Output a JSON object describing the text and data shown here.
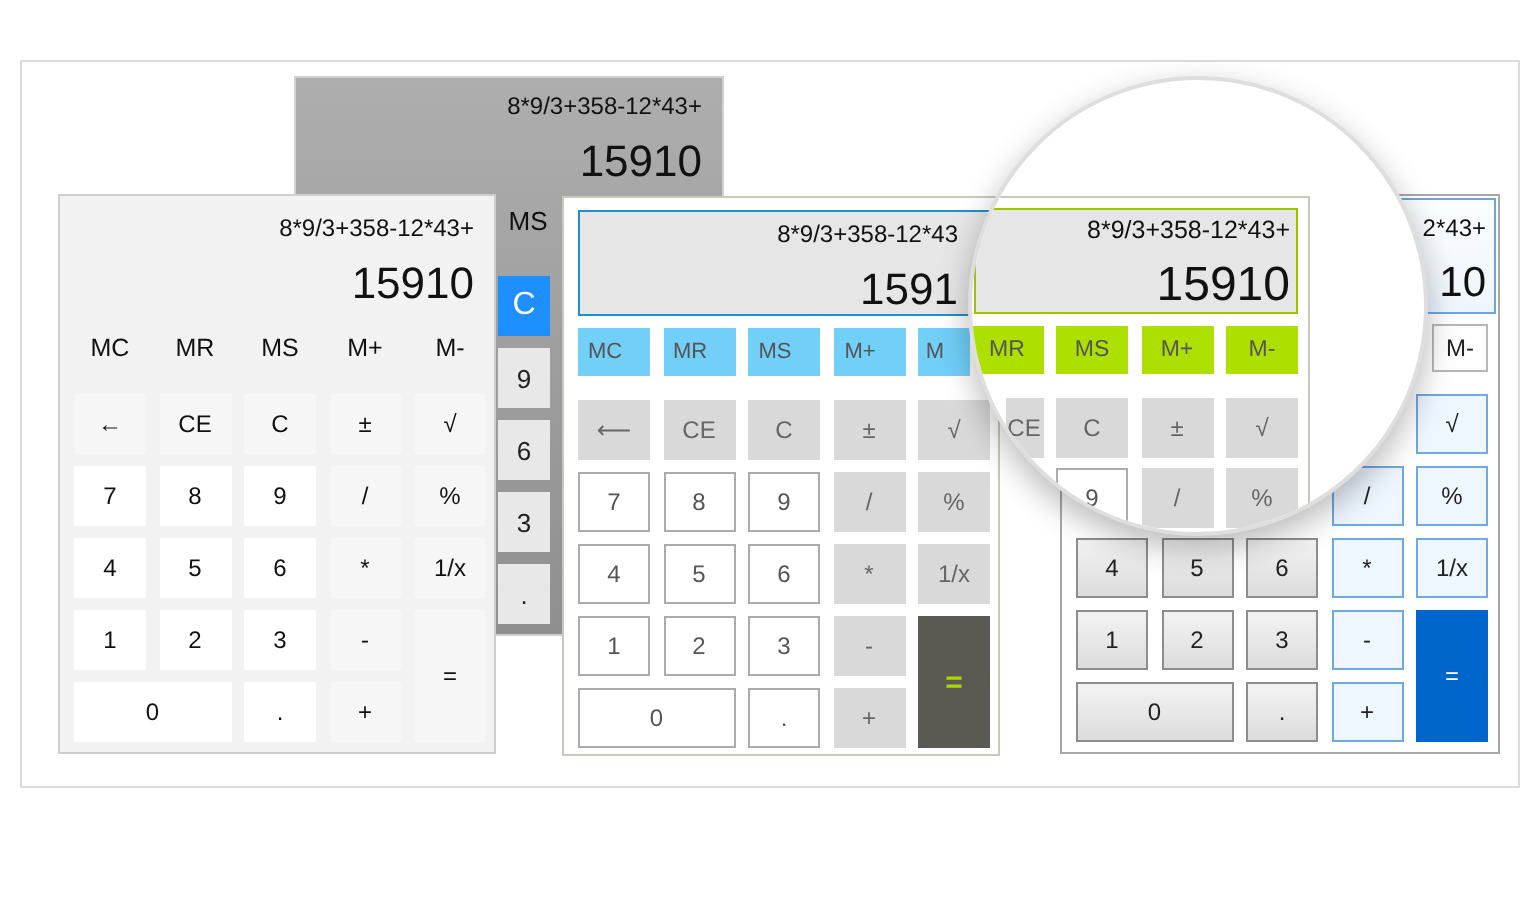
{
  "calculators": [
    {
      "kind": "gray",
      "expression": "8*9/3+358-12*43+",
      "result": "15910",
      "memory_buttons": [
        "MS"
      ],
      "keys": [
        {
          "label": "C",
          "kind": "accent"
        },
        {
          "label": "9",
          "kind": "digit"
        },
        {
          "label": "6",
          "kind": "digit"
        },
        {
          "label": "3",
          "kind": "digit"
        },
        {
          "label": ".",
          "kind": "digit"
        }
      ]
    },
    {
      "kind": "light",
      "expression": "8*9/3+358-12*43+",
      "result": "15910",
      "memory_buttons": [
        "MC",
        "MR",
        "MS",
        "M+",
        "M-"
      ],
      "keys": [
        {
          "label": "←",
          "kind": "op"
        },
        {
          "label": "CE",
          "kind": "op"
        },
        {
          "label": "C",
          "kind": "op"
        },
        {
          "label": "±",
          "kind": "op"
        },
        {
          "label": "√",
          "kind": "op"
        },
        {
          "label": "7",
          "kind": "digit"
        },
        {
          "label": "8",
          "kind": "digit"
        },
        {
          "label": "9",
          "kind": "digit"
        },
        {
          "label": "/",
          "kind": "op"
        },
        {
          "label": "%",
          "kind": "op"
        },
        {
          "label": "4",
          "kind": "digit"
        },
        {
          "label": "5",
          "kind": "digit"
        },
        {
          "label": "6",
          "kind": "digit"
        },
        {
          "label": "*",
          "kind": "op"
        },
        {
          "label": "1/x",
          "kind": "op"
        },
        {
          "label": "1",
          "kind": "digit"
        },
        {
          "label": "2",
          "kind": "digit"
        },
        {
          "label": "3",
          "kind": "digit"
        },
        {
          "label": "-",
          "kind": "op"
        },
        {
          "label": "=",
          "kind": "equals"
        },
        {
          "label": "0",
          "kind": "wide"
        },
        {
          "label": ".",
          "kind": "digit"
        },
        {
          "label": "+",
          "kind": "op"
        }
      ]
    },
    {
      "kind": "green",
      "expression": "8*9/3+358-12*43",
      "result": "1591",
      "memory_buttons": [
        "MC",
        "MR",
        "MS",
        "M+",
        "M"
      ],
      "keys": [
        {
          "label": "⟵",
          "kind": "op"
        },
        {
          "label": "CE",
          "kind": "op"
        },
        {
          "label": "C",
          "kind": "op"
        },
        {
          "label": "±",
          "kind": "op"
        },
        {
          "label": "√",
          "kind": "op"
        },
        {
          "label": "7",
          "kind": "digit"
        },
        {
          "label": "8",
          "kind": "digit"
        },
        {
          "label": "9",
          "kind": "digit"
        },
        {
          "label": "/",
          "kind": "op"
        },
        {
          "label": "%",
          "kind": "op"
        },
        {
          "label": "4",
          "kind": "digit"
        },
        {
          "label": "5",
          "kind": "digit"
        },
        {
          "label": "6",
          "kind": "digit"
        },
        {
          "label": "*",
          "kind": "op"
        },
        {
          "label": "1/x",
          "kind": "op"
        },
        {
          "label": "1",
          "kind": "digit"
        },
        {
          "label": "2",
          "kind": "digit"
        },
        {
          "label": "3",
          "kind": "digit"
        },
        {
          "label": "-",
          "kind": "op"
        },
        {
          "label": "=",
          "kind": "equals"
        },
        {
          "label": "0",
          "kind": "wide"
        },
        {
          "label": ".",
          "kind": "digit"
        },
        {
          "label": "+",
          "kind": "op"
        }
      ]
    },
    {
      "kind": "blue",
      "expression": "2*43+",
      "result": "10",
      "memory_buttons": [
        "M-"
      ],
      "keys": [
        {
          "label": "√",
          "kind": "op"
        },
        {
          "label": "/",
          "kind": "op"
        },
        {
          "label": "%",
          "kind": "op"
        },
        {
          "label": "4",
          "kind": "digit"
        },
        {
          "label": "5",
          "kind": "digit"
        },
        {
          "label": "6",
          "kind": "digit"
        },
        {
          "label": "*",
          "kind": "op"
        },
        {
          "label": "1/x",
          "kind": "op"
        },
        {
          "label": "1",
          "kind": "digit"
        },
        {
          "label": "2",
          "kind": "digit"
        },
        {
          "label": "3",
          "kind": "digit"
        },
        {
          "label": "-",
          "kind": "op"
        },
        {
          "label": "=",
          "kind": "equals"
        },
        {
          "label": "0",
          "kind": "wide"
        },
        {
          "label": ".",
          "kind": "digit"
        },
        {
          "label": "+",
          "kind": "op"
        }
      ]
    }
  ],
  "magnifier": {
    "expression": "8*9/3+358-12*43+",
    "result": "15910",
    "memory_buttons": [
      "MR",
      "MS",
      "M+",
      "M-"
    ],
    "keys": [
      {
        "label": "CE",
        "kind": "op"
      },
      {
        "label": "C",
        "kind": "op"
      },
      {
        "label": "±",
        "kind": "op"
      },
      {
        "label": "√",
        "kind": "op"
      },
      {
        "label": "9",
        "kind": "digit"
      },
      {
        "label": "/",
        "kind": "op"
      },
      {
        "label": "%",
        "kind": "op"
      }
    ]
  }
}
